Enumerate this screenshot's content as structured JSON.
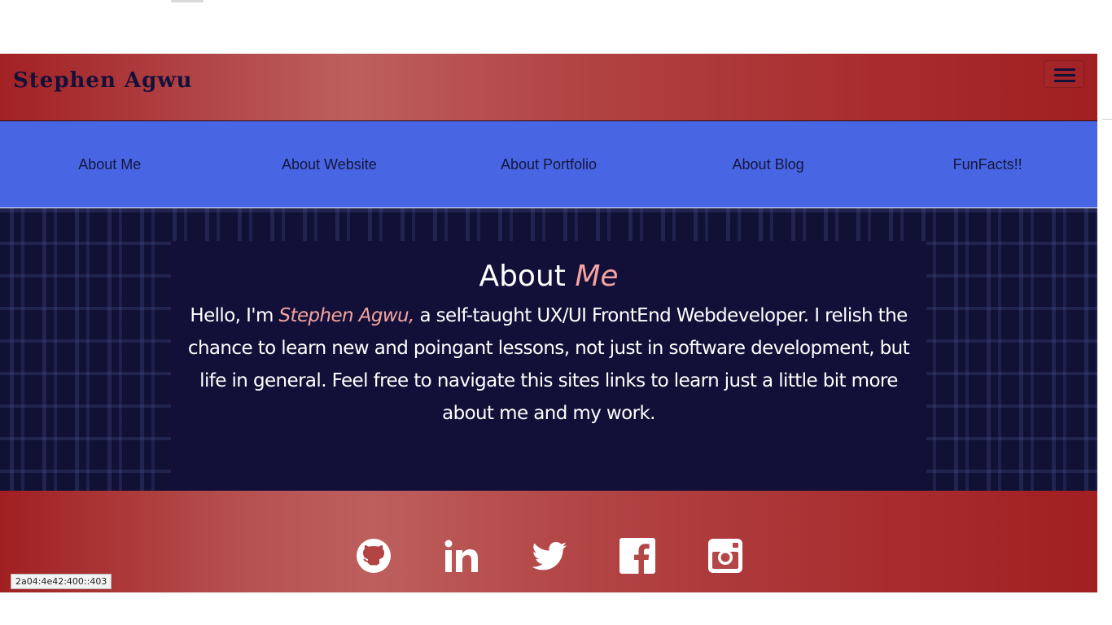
{
  "header": {
    "brand": "Stephen Agwu",
    "menu_icon": "hamburger-icon"
  },
  "nav": {
    "items": [
      {
        "label": "About Me"
      },
      {
        "label": "About Website"
      },
      {
        "label": "About Portfolio"
      },
      {
        "label": "About Blog"
      },
      {
        "label": "FunFacts!!"
      }
    ]
  },
  "about": {
    "title_main": "About",
    "title_accent": "Me",
    "intro": "Hello, I'm",
    "name": "Stephen Agwu,",
    "body": "a self-taught UX/UI FrontEnd Webdeveloper. I relish the chance to learn new and poingant lessons, not just in software development, but life in general. Feel free to navigate this sites links to learn just a little bit more about me and my work."
  },
  "footer": {
    "icons": [
      "github-icon",
      "linkedin-icon",
      "twitter-icon",
      "facebook-icon",
      "instagram-icon"
    ]
  },
  "status": {
    "ip": "2a04:4e42:400::403"
  },
  "colors": {
    "header_red": "#a32124",
    "nav_blue": "#4866e3",
    "about_bg": "#111136",
    "accent_pink": "#f4a3a0",
    "brand_navy": "#14103a"
  }
}
